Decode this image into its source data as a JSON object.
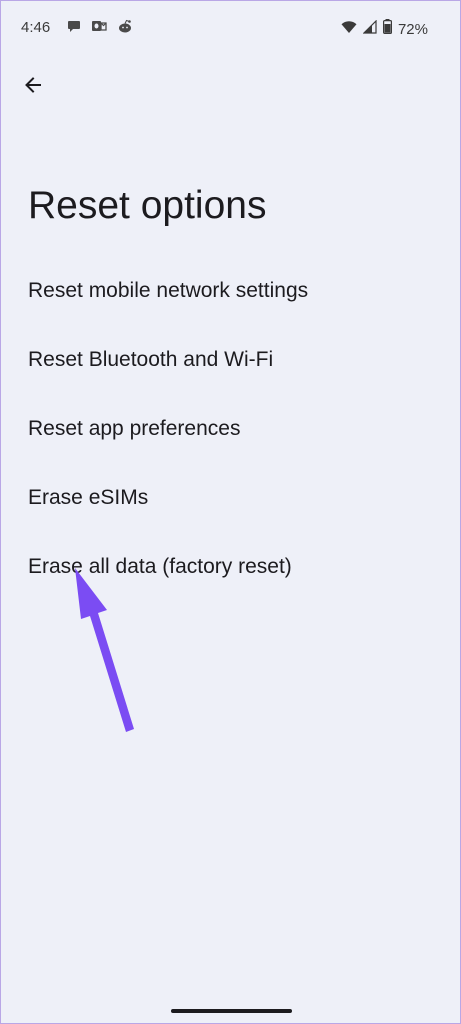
{
  "status_bar": {
    "time": "4:46",
    "battery_percent": "72%",
    "left_icons": [
      "chat-bubble-icon",
      "outlook-icon",
      "reddit-icon"
    ],
    "right_icons": [
      "wifi-icon",
      "cellular-signal-icon",
      "battery-icon"
    ]
  },
  "header": {
    "back_icon": "arrow-left-icon"
  },
  "page": {
    "title": "Reset options"
  },
  "options": [
    {
      "label": "Reset mobile network settings"
    },
    {
      "label": "Reset Bluetooth and Wi-Fi"
    },
    {
      "label": "Reset app preferences"
    },
    {
      "label": "Erase eSIMs"
    },
    {
      "label": "Erase all data (factory reset)"
    }
  ],
  "annotation": {
    "arrow_color": "#7b4cf3"
  },
  "colors": {
    "background": "#eef0f8",
    "text": "#1c1b1f"
  }
}
